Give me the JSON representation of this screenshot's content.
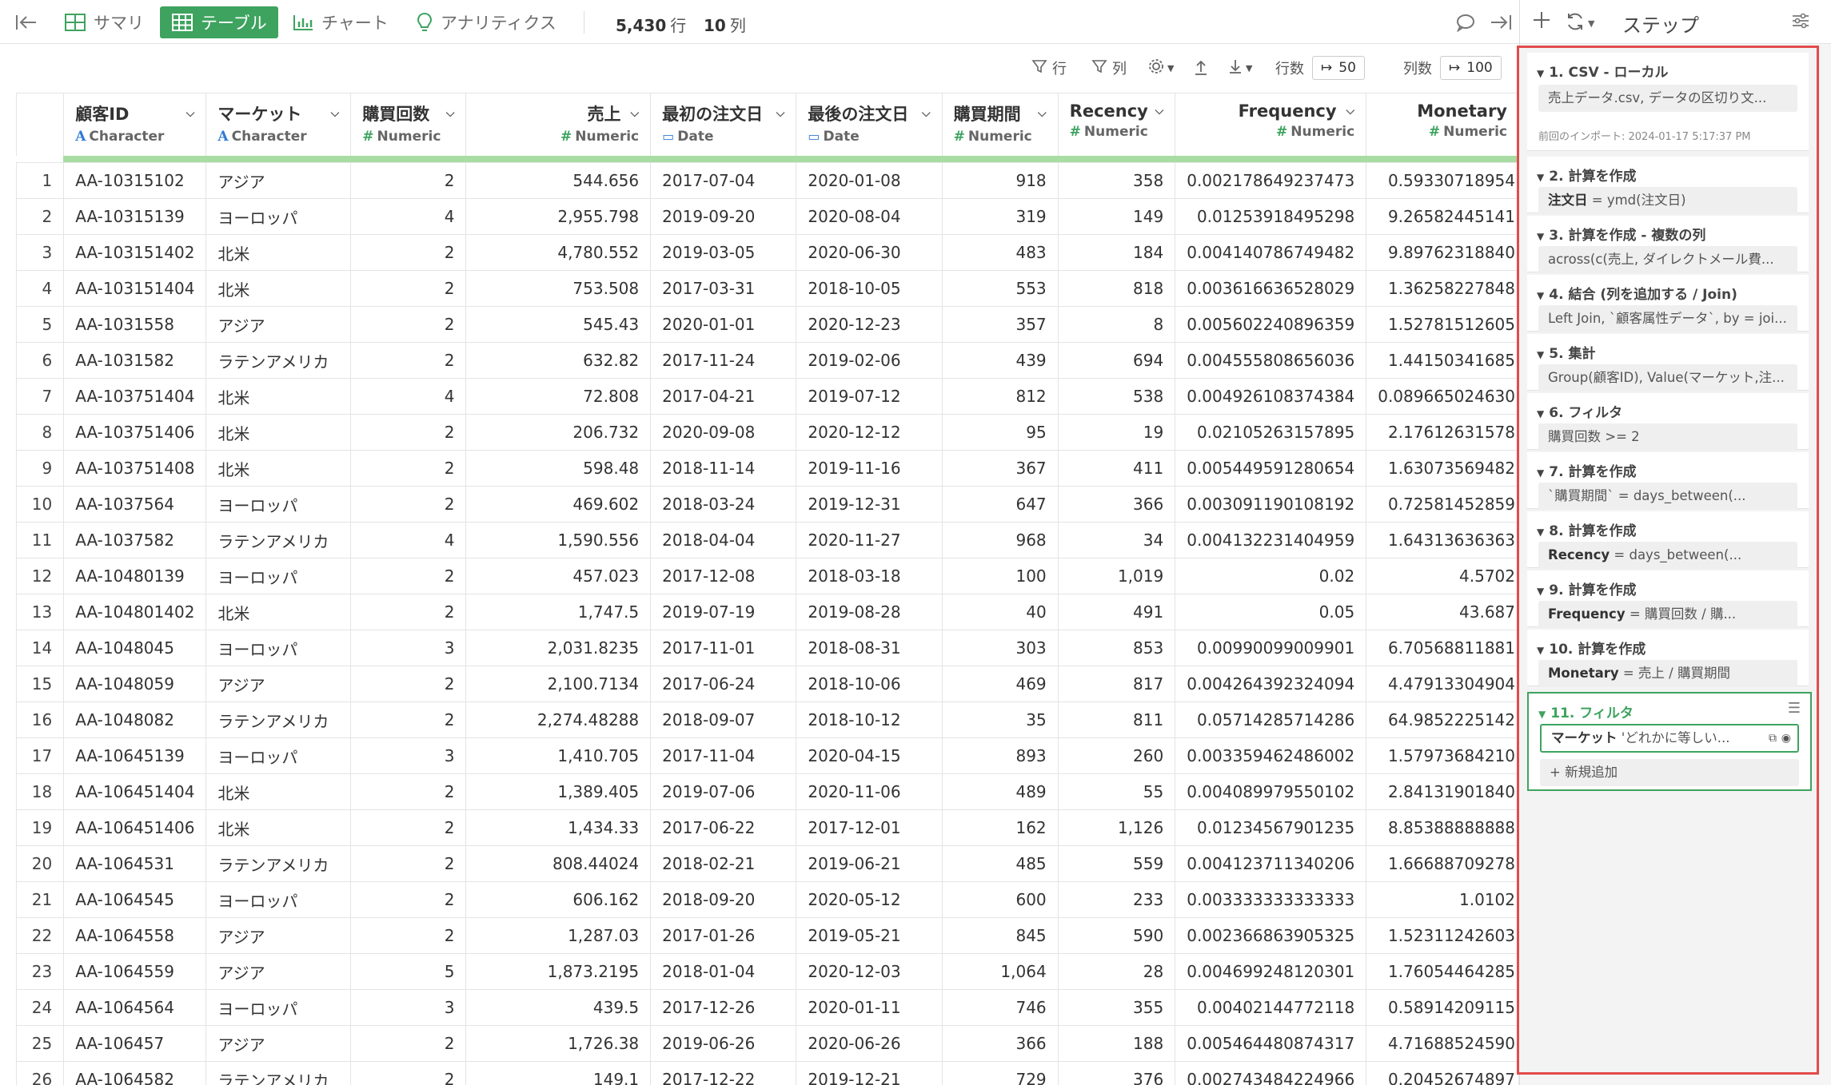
{
  "topbar": {
    "summary_label": "サマリ",
    "table_label": "テーブル",
    "chart_label": "チャート",
    "analytics_label": "アナリティクス",
    "row_count": "5,430",
    "row_unit": "行",
    "col_count": "10",
    "col_unit": "列"
  },
  "subtoolbar": {
    "row_filter": "行",
    "col_filter": "列",
    "rows_label": "行数",
    "rows_value": "50",
    "cols_label": "列数",
    "cols_value": "100"
  },
  "table": {
    "columns": [
      {
        "name": "顧客ID",
        "type": "Character",
        "type_symbol": "A"
      },
      {
        "name": "マーケット",
        "type": "Character",
        "type_symbol": "A"
      },
      {
        "name": "購買回数",
        "type": "Numeric",
        "type_symbol": "#"
      },
      {
        "name": "売上",
        "type": "Numeric",
        "type_symbol": "#"
      },
      {
        "name": "最初の注文日",
        "type": "Date",
        "type_symbol": "calendar"
      },
      {
        "name": "最後の注文日",
        "type": "Date",
        "type_symbol": "calendar"
      },
      {
        "name": "購買期間",
        "type": "Numeric",
        "type_symbol": "#"
      },
      {
        "name": "Recency",
        "type": "Numeric",
        "type_symbol": "#"
      },
      {
        "name": "Frequency",
        "type": "Numeric",
        "type_symbol": "#"
      },
      {
        "name": "Monetary",
        "type": "Numeric",
        "type_symbol": "#"
      }
    ],
    "rows": [
      [
        "1",
        "AA-10315102",
        "アジア",
        "2",
        "544.656",
        "2017-07-04",
        "2020-01-08",
        "918",
        "358",
        "0.002178649237473",
        "0.59330718954"
      ],
      [
        "2",
        "AA-10315139",
        "ヨーロッパ",
        "4",
        "2,955.798",
        "2019-09-20",
        "2020-08-04",
        "319",
        "149",
        "0.01253918495298",
        "9.26582445141"
      ],
      [
        "3",
        "AA-103151402",
        "北米",
        "2",
        "4,780.552",
        "2019-03-05",
        "2020-06-30",
        "483",
        "184",
        "0.004140786749482",
        "9.89762318840"
      ],
      [
        "4",
        "AA-103151404",
        "北米",
        "2",
        "753.508",
        "2017-03-31",
        "2018-10-05",
        "553",
        "818",
        "0.003616636528029",
        "1.36258227848"
      ],
      [
        "5",
        "AA-1031558",
        "アジア",
        "2",
        "545.43",
        "2020-01-01",
        "2020-12-23",
        "357",
        "8",
        "0.005602240896359",
        "1.52781512605"
      ],
      [
        "6",
        "AA-1031582",
        "ラテンアメリカ",
        "2",
        "632.82",
        "2017-11-24",
        "2019-02-06",
        "439",
        "694",
        "0.004555808656036",
        "1.44150341685"
      ],
      [
        "7",
        "AA-103751404",
        "北米",
        "4",
        "72.808",
        "2017-04-21",
        "2019-07-12",
        "812",
        "538",
        "0.004926108374384",
        "0.089665024630"
      ],
      [
        "8",
        "AA-103751406",
        "北米",
        "2",
        "206.732",
        "2020-09-08",
        "2020-12-12",
        "95",
        "19",
        "0.02105263157895",
        "2.17612631578"
      ],
      [
        "9",
        "AA-103751408",
        "北米",
        "2",
        "598.48",
        "2018-11-14",
        "2019-11-16",
        "367",
        "411",
        "0.005449591280654",
        "1.63073569482"
      ],
      [
        "10",
        "AA-1037564",
        "ヨーロッパ",
        "2",
        "469.602",
        "2018-03-24",
        "2019-12-31",
        "647",
        "366",
        "0.003091190108192",
        "0.72581452859"
      ],
      [
        "11",
        "AA-1037582",
        "ラテンアメリカ",
        "4",
        "1,590.556",
        "2018-04-04",
        "2020-11-27",
        "968",
        "34",
        "0.004132231404959",
        "1.64313636363"
      ],
      [
        "12",
        "AA-10480139",
        "ヨーロッパ",
        "2",
        "457.023",
        "2017-12-08",
        "2018-03-18",
        "100",
        "1,019",
        "0.02",
        "4.5702"
      ],
      [
        "13",
        "AA-104801402",
        "北米",
        "2",
        "1,747.5",
        "2019-07-19",
        "2019-08-28",
        "40",
        "491",
        "0.05",
        "43.687"
      ],
      [
        "14",
        "AA-1048045",
        "ヨーロッパ",
        "3",
        "2,031.8235",
        "2017-11-01",
        "2018-08-31",
        "303",
        "853",
        "0.00990099009901",
        "6.70568811881"
      ],
      [
        "15",
        "AA-1048059",
        "アジア",
        "2",
        "2,100.7134",
        "2017-06-24",
        "2018-10-06",
        "469",
        "817",
        "0.004264392324094",
        "4.47913304904"
      ],
      [
        "16",
        "AA-1048082",
        "ラテンアメリカ",
        "2",
        "2,274.48288",
        "2018-09-07",
        "2018-10-12",
        "35",
        "811",
        "0.05714285714286",
        "64.9852225142"
      ],
      [
        "17",
        "AA-10645139",
        "ヨーロッパ",
        "3",
        "1,410.705",
        "2017-11-04",
        "2020-04-15",
        "893",
        "260",
        "0.003359462486002",
        "1.57973684210"
      ],
      [
        "18",
        "AA-106451404",
        "北米",
        "2",
        "1,389.405",
        "2019-07-06",
        "2020-11-06",
        "489",
        "55",
        "0.004089979550102",
        "2.84131901840"
      ],
      [
        "19",
        "AA-106451406",
        "北米",
        "2",
        "1,434.33",
        "2017-06-22",
        "2017-12-01",
        "162",
        "1,126",
        "0.01234567901235",
        "8.85388888888"
      ],
      [
        "20",
        "AA-1064531",
        "ラテンアメリカ",
        "2",
        "808.44024",
        "2018-02-21",
        "2019-06-21",
        "485",
        "559",
        "0.004123711340206",
        "1.66688709278"
      ],
      [
        "21",
        "AA-1064545",
        "ヨーロッパ",
        "2",
        "606.162",
        "2018-09-20",
        "2020-05-12",
        "600",
        "233",
        "0.003333333333333",
        "1.0102"
      ],
      [
        "22",
        "AA-1064558",
        "アジア",
        "2",
        "1,287.03",
        "2017-01-26",
        "2019-05-21",
        "845",
        "590",
        "0.002366863905325",
        "1.52311242603"
      ],
      [
        "23",
        "AA-1064559",
        "アジア",
        "5",
        "1,873.2195",
        "2018-01-04",
        "2020-12-03",
        "1,064",
        "28",
        "0.004699248120301",
        "1.76054464285"
      ],
      [
        "24",
        "AA-1064564",
        "ヨーロッパ",
        "3",
        "439.5",
        "2017-12-26",
        "2020-01-11",
        "746",
        "355",
        "0.00402144772118",
        "0.58914209115"
      ],
      [
        "25",
        "AA-106457",
        "アジア",
        "2",
        "1,726.38",
        "2019-06-26",
        "2020-06-26",
        "366",
        "188",
        "0.005464480874317",
        "4.71688524590"
      ],
      [
        "26",
        "AA-1064582",
        "ラテンアメリカ",
        "2",
        "149.1",
        "2017-12-22",
        "2019-12-21",
        "729",
        "376",
        "0.002743484224966",
        "0.20452674897"
      ]
    ]
  },
  "steps_panel": {
    "title": "ステップ",
    "steps": [
      {
        "header": "1. CSV - ローカル",
        "body": "売上データ.csv, データの区切り文...",
        "meta": "前回のインポート: 2024-01-17 5:17:37 PM"
      },
      {
        "header": "2. 計算を作成",
        "body_key": "注文日",
        "body": " = ymd(注文日)"
      },
      {
        "header": "3. 計算を作成 - 複数の列",
        "body": "across(c(売上, ダイレクトメール費..."
      },
      {
        "header": "4. 結合 (列を追加する / Join)",
        "body": "Left Join, `顧客属性データ`, by = joi..."
      },
      {
        "header": "5. 集計",
        "body": "Group(顧客ID), Value(マーケット,注..."
      },
      {
        "header": "6. フィルタ",
        "body": "購買回数 >= 2"
      },
      {
        "header": "7. 計算を作成",
        "body": "`購買期間` = days_between(..."
      },
      {
        "header": "8. 計算を作成",
        "body_key": "Recency",
        "body": " = days_between(..."
      },
      {
        "header": "9. 計算を作成",
        "body_key": "Frequency",
        "body": " = 購買回数 / 購..."
      },
      {
        "header": "10. 計算を作成",
        "body_key": "Monetary",
        "body": " = 売上 / 購買期間"
      },
      {
        "header": "11. フィルタ",
        "body_key": "マーケット",
        "body": " 'どれかに等しい...",
        "add_label": "+ 新規追加"
      }
    ]
  },
  "colors": {
    "accent_green": "#3ea35f",
    "highlight_red": "#e34b4b",
    "type_blue": "#2f7bd6",
    "quality_bar": "#a8dca2"
  }
}
